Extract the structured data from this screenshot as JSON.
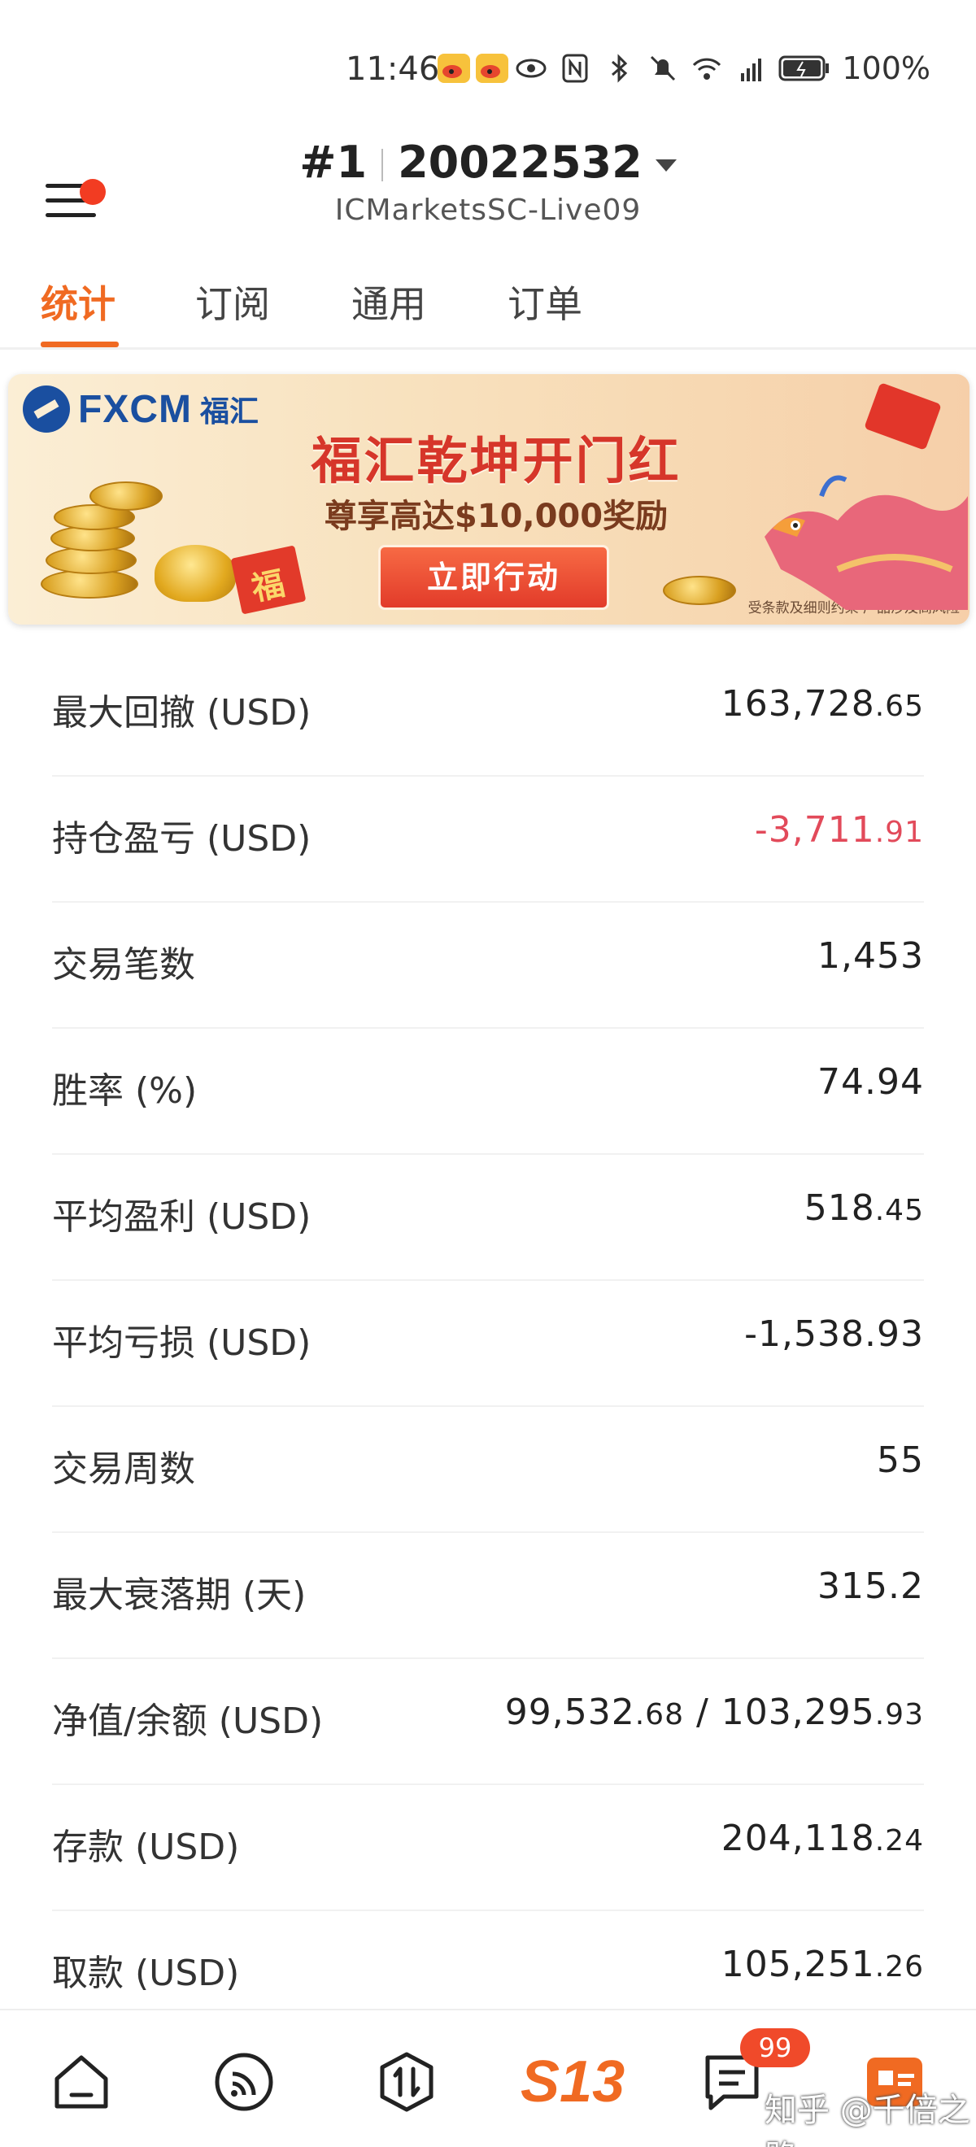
{
  "status_bar": {
    "time": "11:46",
    "battery": "100%",
    "icons": [
      "weibo-icon",
      "weibo-icon",
      "eye-icon",
      "nfc-icon",
      "bluetooth-icon",
      "mute-bell-icon",
      "wifi-icon",
      "signal-5g-icon",
      "battery-icon"
    ]
  },
  "header": {
    "account_index": "#1",
    "account_number": "20022532",
    "server": "ICMarketsSC-Live09",
    "menu_icon": "hamburger-menu-icon",
    "notification_dot_color": "#f23c22"
  },
  "tabs": [
    {
      "label": "统计",
      "active": true
    },
    {
      "label": "订阅",
      "active": false
    },
    {
      "label": "通用",
      "active": false
    },
    {
      "label": "订单",
      "active": false
    }
  ],
  "banner": {
    "brand": "FXCM",
    "brand_cn": "福汇",
    "headline": "福汇乾坤开门红",
    "subline": "尊享高达$10,000奖励",
    "cta": "立即行动",
    "disclaimer": "受条款及细则约束  产品涉及高风险",
    "fu_char": "福"
  },
  "stats": [
    {
      "label": "最大回撤 (USD)",
      "int": "163,728",
      "frac": ".65"
    },
    {
      "label": "持仓盈亏 (USD)",
      "int": "-3,711",
      "frac": ".91",
      "color": "#e24a5a"
    },
    {
      "label": "交易笔数",
      "int": "1,453",
      "frac": ""
    },
    {
      "label": "胜率 (%)",
      "int": "74.94",
      "frac": ""
    },
    {
      "label": "平均盈利 (USD)",
      "int": "518",
      "frac": ".45"
    },
    {
      "label": "平均亏损 (USD)",
      "int": "-1,538.93",
      "frac": ""
    },
    {
      "label": "交易周数",
      "int": "55",
      "frac": ""
    },
    {
      "label": "最大衰落期 (天)",
      "int": "315.2",
      "frac": ""
    },
    {
      "label": "净值/余额 (USD)",
      "int": "99,532",
      "frac": ".68",
      "int2": " / 103,295",
      "frac2": ".93"
    },
    {
      "label": "存款 (USD)",
      "int": "204,118",
      "frac": ".24"
    },
    {
      "label": "取款 (USD)",
      "int": "105,251",
      "frac": ".26"
    }
  ],
  "bottom_nav": {
    "items": [
      "home-icon",
      "feed-icon",
      "trade-icon",
      "s13-logo-icon",
      "message-icon",
      "profile-icon"
    ],
    "brand_label": "S13",
    "badge": "99",
    "watermark": "知乎 @千倍之路"
  },
  "colors": {
    "accent": "#f06a22",
    "negative": "#e24a5a",
    "brand_blue": "#1a4fa0"
  }
}
